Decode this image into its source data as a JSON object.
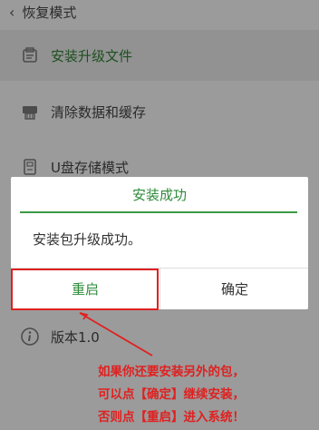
{
  "topbar": {
    "back_icon": "‹",
    "title": "恢复模式"
  },
  "menu": {
    "items": [
      {
        "label": "安装升级文件",
        "icon": "package-icon"
      },
      {
        "label": "清除数据和缓存",
        "icon": "printer-icon"
      },
      {
        "label": "U盘存储模式",
        "icon": "usb-storage-icon"
      },
      {
        "label": "版本1.0",
        "icon": "info-icon"
      }
    ]
  },
  "dialog": {
    "title": "安装成功",
    "message": "安装包升级成功。",
    "restart_label": "重启",
    "ok_label": "确定"
  },
  "annotation": {
    "lines": [
      "如果你还要安装另外的包，",
      "可以点【确定】继续安装，",
      "否则点【重启】进入系统！"
    ]
  },
  "colors": {
    "accent_green": "#2e8b3a",
    "annotation_red": "#e02020"
  }
}
